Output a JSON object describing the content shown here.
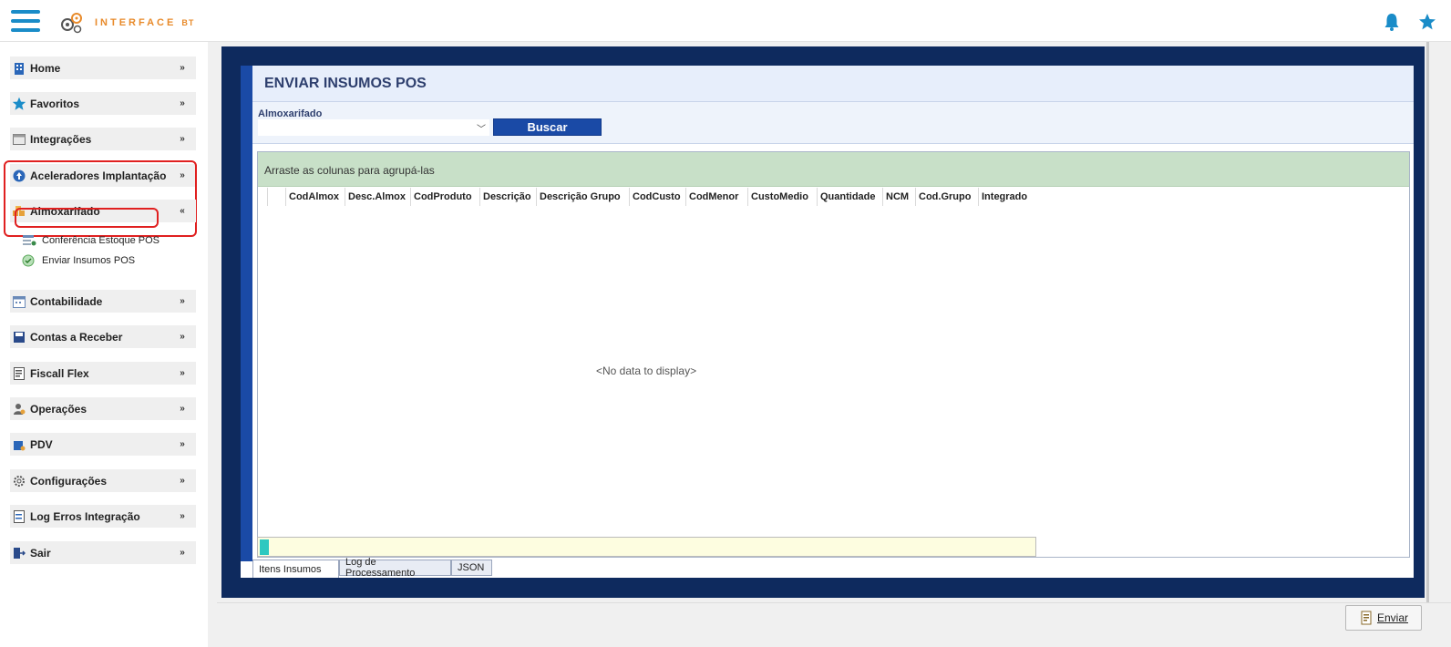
{
  "header": {
    "brand": "INTERFACE",
    "brand_sub": "BT"
  },
  "sidebar": {
    "items": [
      {
        "label": "Home",
        "icon": "building-icon"
      },
      {
        "label": "Favoritos",
        "icon": "star-icon"
      },
      {
        "label": "Integrações",
        "icon": "window-icon"
      },
      {
        "label": "Aceleradores Implantação",
        "icon": "arrow-up-circle-icon"
      },
      {
        "label": "Almoxarifado",
        "icon": "boxes-icon"
      },
      {
        "label": "Contabilidade",
        "icon": "calendar-icon"
      },
      {
        "label": "Contas a Receber",
        "icon": "disk-icon"
      },
      {
        "label": "Fiscall Flex",
        "icon": "document-icon"
      },
      {
        "label": "Operações",
        "icon": "person-gear-icon"
      },
      {
        "label": "PDV",
        "icon": "pdv-icon"
      },
      {
        "label": "Configurações",
        "icon": "gear-icon"
      },
      {
        "label": "Log Erros Integração",
        "icon": "log-icon"
      },
      {
        "label": "Sair",
        "icon": "exit-icon"
      }
    ],
    "submenu": [
      {
        "label": "Conferência Estoque POS",
        "icon": "list-icon"
      },
      {
        "label": "Enviar Insumos POS",
        "icon": "check-circle-icon"
      }
    ]
  },
  "main": {
    "title": "ENVIAR INSUMOS POS",
    "filter": {
      "label": "Almoxarifado",
      "value": ""
    },
    "search_button": "Buscar",
    "grid": {
      "group_hint": "Arraste as colunas para agrupá-las",
      "columns": [
        "CodAlmox",
        "Desc.Almox",
        "CodProduto",
        "Descrição",
        "Descrição Grupo",
        "CodCusto",
        "CodMenor",
        "CustoMedio",
        "Quantidade",
        "NCM",
        "Cod.Grupo",
        "Integrado"
      ],
      "empty_text": "<No data to display>"
    },
    "tabs": [
      "Itens Insumos",
      "Log de Processamento",
      "JSON"
    ],
    "active_tab": "Itens Insumos"
  },
  "footer": {
    "send_button": "Enviar"
  },
  "colors": {
    "frame": "#0e2a5e",
    "accent_blue": "#1a4aa6",
    "group_panel": "#c8e0c8",
    "highlight_red": "#e02020",
    "brand_orange": "#e88a2a"
  }
}
